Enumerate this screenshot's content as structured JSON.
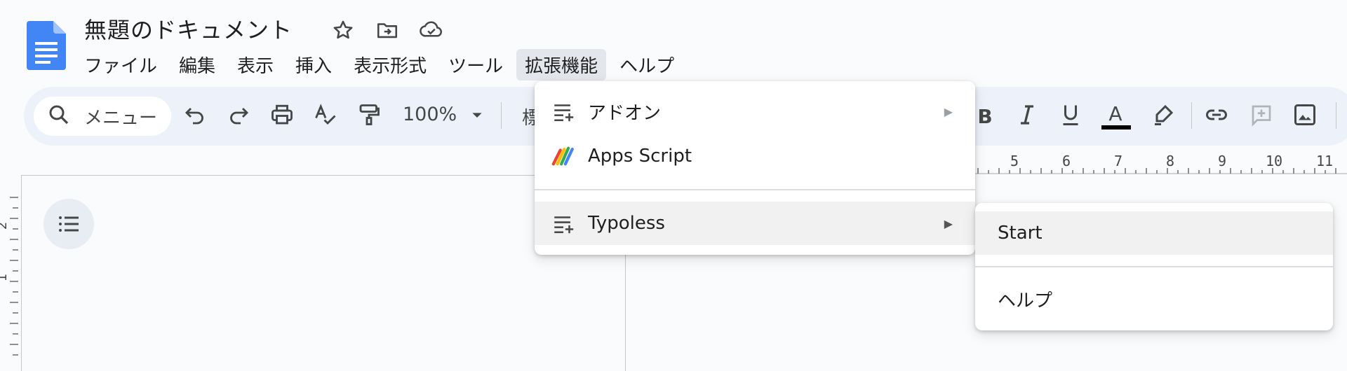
{
  "document": {
    "title": "無題のドキュメント"
  },
  "menubar": {
    "items": [
      {
        "label": "ファイル"
      },
      {
        "label": "編集"
      },
      {
        "label": "表示"
      },
      {
        "label": "挿入"
      },
      {
        "label": "表示形式"
      },
      {
        "label": "ツール"
      },
      {
        "label": "拡張機能",
        "active": true
      },
      {
        "label": "ヘルプ"
      }
    ]
  },
  "toolbar": {
    "search_placeholder": "メニュー",
    "zoom": "100%",
    "style_peek": "標",
    "icons": [
      "search-icon",
      "undo-icon",
      "redo-icon",
      "print-icon",
      "spellcheck-icon",
      "paint-format-icon",
      "chevron-down-icon",
      "bold-icon",
      "italic-icon",
      "underline-icon",
      "text-color-icon",
      "highlight-icon",
      "link-icon",
      "add-comment-icon",
      "insert-image-icon"
    ],
    "bold_label": "B",
    "text_color_label": "A",
    "text_color": "#000000"
  },
  "ruler": {
    "ticks": [
      "5",
      "6",
      "7",
      "8",
      "9",
      "10",
      "11"
    ]
  },
  "vertical_ruler": {
    "ticks": [
      "2",
      "1"
    ]
  },
  "extensions_menu": {
    "items": [
      {
        "label": "アドオン",
        "icon": "add-on-icon",
        "has_submenu": true
      },
      {
        "label": "Apps Script",
        "icon": "apps-script-icon",
        "has_submenu": false
      },
      {
        "label": "Typoless",
        "icon": "add-on-icon",
        "has_submenu": true,
        "highlighted": true
      }
    ],
    "submenu_arrow": "▶"
  },
  "typoless_submenu": {
    "items": [
      {
        "label": "Start",
        "highlighted": true
      },
      {
        "label": "ヘルプ"
      }
    ]
  },
  "colors": {
    "accent_blue": "#4285f4",
    "menu_active_bg": "#e3e6ea",
    "toolbar_bg": "#edf2fa"
  }
}
